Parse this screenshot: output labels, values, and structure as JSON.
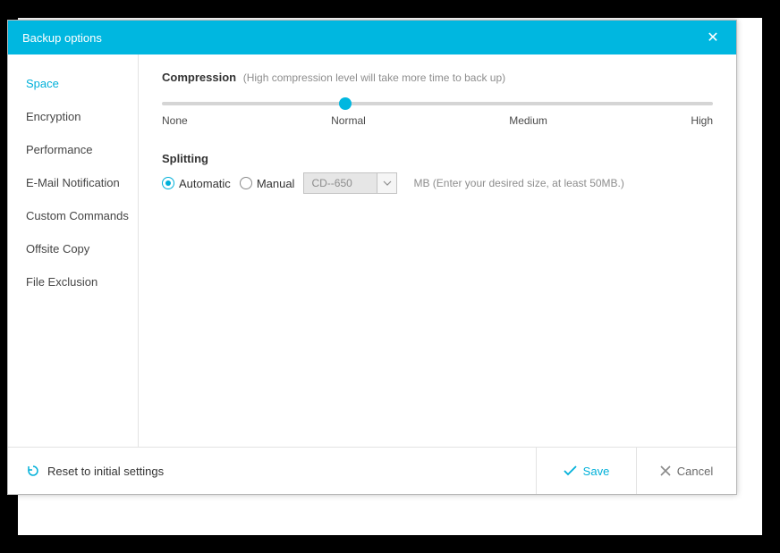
{
  "header": {
    "title": "Backup options"
  },
  "sidebar": {
    "items": [
      {
        "label": "Space"
      },
      {
        "label": "Encryption"
      },
      {
        "label": "Performance"
      },
      {
        "label": "E-Mail Notification"
      },
      {
        "label": "Custom Commands"
      },
      {
        "label": "Offsite Copy"
      },
      {
        "label": "File Exclusion"
      }
    ]
  },
  "content": {
    "compression": {
      "label": "Compression",
      "hint": "(High compression level will take more time to back up)",
      "ticks": [
        "None",
        "Normal",
        "Medium",
        "High"
      ],
      "value_index": 1
    },
    "splitting": {
      "label": "Splitting",
      "automatic": "Automatic",
      "manual": "Manual",
      "selected": "automatic",
      "size_value": "CD--650",
      "note": "MB (Enter your desired size, at least 50MB.)"
    }
  },
  "footer": {
    "reset": "Reset to initial settings",
    "save": "Save",
    "cancel": "Cancel"
  }
}
